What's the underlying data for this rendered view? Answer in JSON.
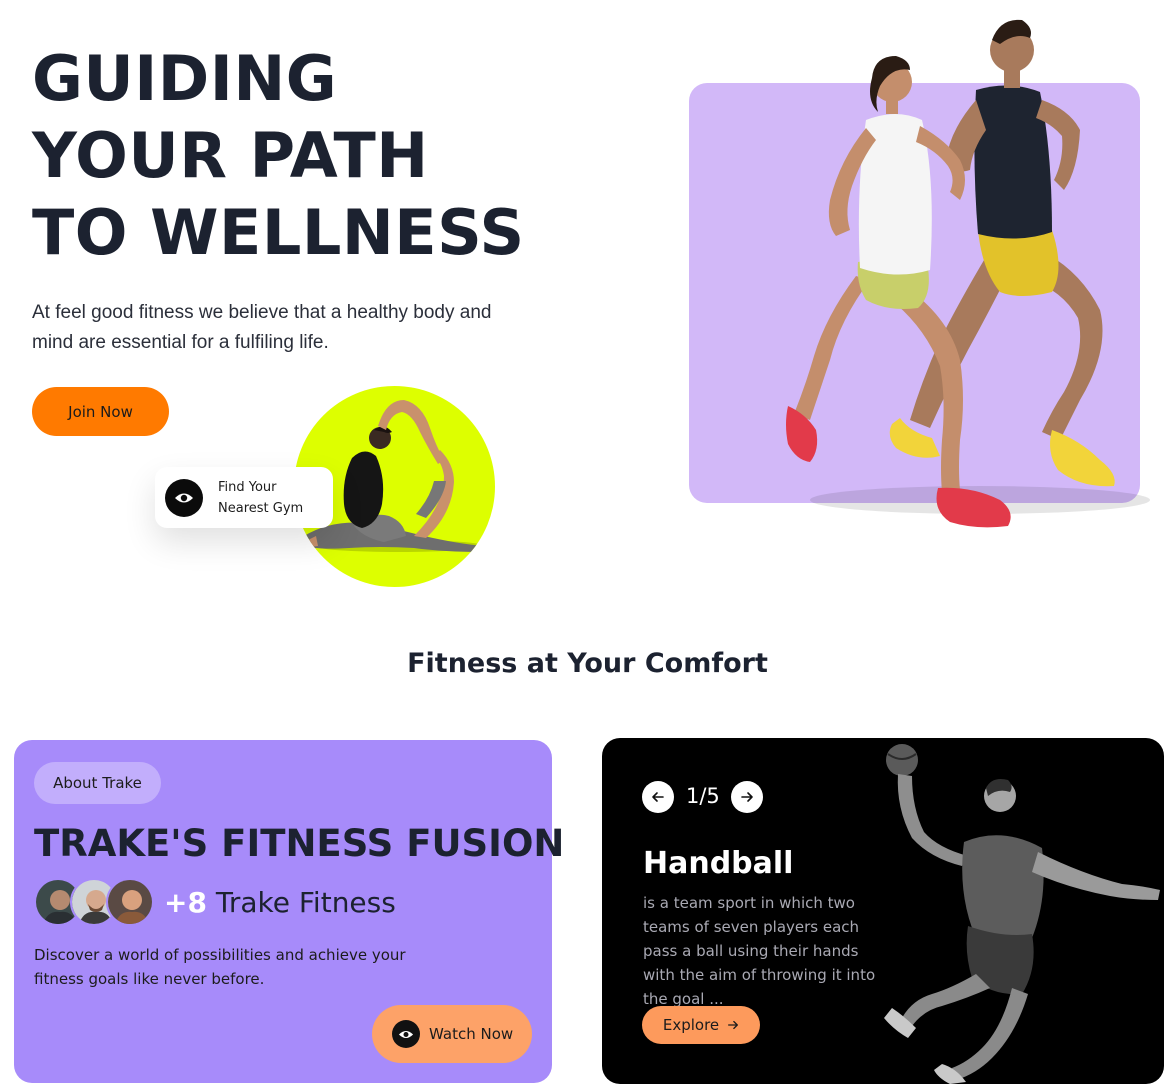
{
  "hero": {
    "title_lines": [
      "GUIDING",
      "YOUR PATH",
      "TO WELLNESS"
    ],
    "description": "At feel good fitness we believe that a healthy body and mind are essential for a fulfiling life.",
    "cta_label": "Join Now",
    "gym_card": {
      "line1": "Find Your",
      "line2": "Nearest Gym",
      "icon": "eye-icon"
    }
  },
  "section": {
    "title": "Fitness at Your Comfort"
  },
  "about_card": {
    "pill": "About Trake",
    "title": "TRAKE'S FITNESS FUSION",
    "community_count": "+8",
    "community_label": "Trake Fitness",
    "description": "Discover a world of possibilities and achieve your fitness goals like never before.",
    "watch_label": "Watch Now"
  },
  "sport_card": {
    "counter": "1/5",
    "name": "Handball",
    "description": " is a team sport in which two teams of seven players each pass a ball using their hands with the aim of throwing it into the goal ...",
    "explore_label": "Explore",
    "prev_icon": "arrow-left-icon",
    "next_icon": "arrow-right-icon"
  },
  "colors": {
    "dark_text": "#1c2230",
    "orange": "#ff7a00",
    "lime": "#ddff00",
    "lavender_panel": "#d2b8f8",
    "purple_card": "#a78bfa",
    "peach_button": "#fda268",
    "black_card": "#000000"
  }
}
